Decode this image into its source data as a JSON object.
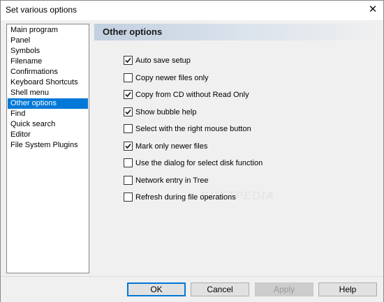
{
  "window": {
    "title": "Set various options",
    "close_glyph": "✕"
  },
  "nav": {
    "selected_index": 8,
    "items": [
      {
        "label": "Main program"
      },
      {
        "label": "Panel"
      },
      {
        "label": "Symbols"
      },
      {
        "label": "Filename"
      },
      {
        "label": "Confirmations"
      },
      {
        "label": "Keyboard Shortcuts"
      },
      {
        "label": "Shell menu"
      },
      {
        "label": "Other options"
      },
      {
        "label": "Find"
      },
      {
        "label": "Quick search"
      },
      {
        "label": "Editor"
      },
      {
        "label": "File System Plugins"
      }
    ]
  },
  "section": {
    "title": "Other options"
  },
  "options": [
    {
      "label": "Auto save setup",
      "checked": true
    },
    {
      "label": "Copy newer files only",
      "checked": false
    },
    {
      "label": "Copy from CD without Read Only",
      "checked": true
    },
    {
      "label": "Show bubble help",
      "checked": true
    },
    {
      "label": "Select with the right mouse button",
      "checked": false
    },
    {
      "label": "Mark only newer files",
      "checked": true
    },
    {
      "label": "Use the dialog for select disk function",
      "checked": false
    },
    {
      "label": "Network entry in Tree",
      "checked": false
    },
    {
      "label": "Refresh during file operations",
      "checked": false
    }
  ],
  "watermark": "SOFTPEDIA",
  "buttons": {
    "ok": "OK",
    "cancel": "Cancel",
    "apply": "Apply",
    "help": "Help"
  },
  "colors": {
    "selection": "#0078d7",
    "default_button_border": "#0078d7"
  }
}
